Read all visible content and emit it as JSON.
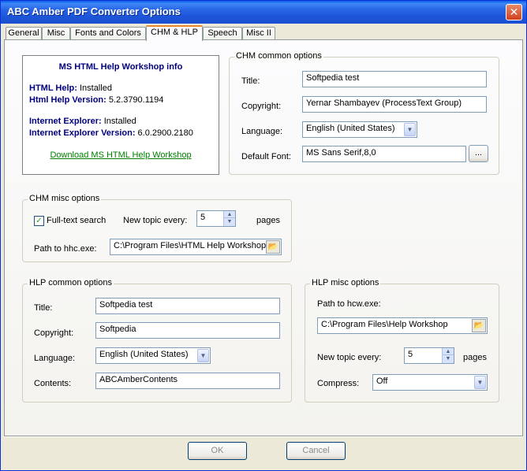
{
  "window": {
    "title": "ABC Amber PDF Converter Options",
    "close_glyph": "✕"
  },
  "tabs": [
    {
      "label": "General"
    },
    {
      "label": "Misc"
    },
    {
      "label": "Fonts and Colors"
    },
    {
      "label": "CHM & HLP"
    },
    {
      "label": "Speech"
    },
    {
      "label": "Misc II"
    }
  ],
  "info": {
    "heading": "MS HTML Help Workshop info",
    "html_help_label": "HTML Help:",
    "html_help_value": " Installed",
    "html_help_version_label": "Html Help Version:",
    "html_help_version_value": " 5.2.3790.1194",
    "ie_label": "Internet Explorer:",
    "ie_value": " Installed",
    "ie_version_label": "Internet Explorer Version:",
    "ie_version_value": " 6.0.2900.2180",
    "download_link": "Download MS HTML Help Workshop"
  },
  "chm_common": {
    "title": "CHM common options",
    "title_label": "Title:",
    "title_value": "Softpedia test",
    "copyright_label": "Copyright:",
    "copyright_value": "Yernar Shambayev (ProcessText Group)",
    "language_label": "Language:",
    "language_value": "English (United States)",
    "font_label": "Default Font:",
    "font_value": "MS Sans Serif,8,0",
    "font_button": "..."
  },
  "chm_misc": {
    "title": "CHM misc options",
    "fulltext_label": "Full-text search",
    "fulltext_checked": true,
    "new_topic_label": "New topic every:",
    "new_topic_value": "5",
    "pages_label": "pages",
    "path_label": "Path to hhc.exe:",
    "path_value": "C:\\Program Files\\HTML Help Workshop"
  },
  "hlp_common": {
    "title": "HLP common options",
    "title_label": "Title:",
    "title_value": "Softpedia test",
    "copyright_label": "Copyright:",
    "copyright_value": "Softpedia",
    "language_label": "Language:",
    "language_value": "English (United States)",
    "contents_label": "Contents:",
    "contents_value": "ABCAmberContents"
  },
  "hlp_misc": {
    "title": "HLP misc options",
    "path_label": "Path to hcw.exe:",
    "path_value": "C:\\Program Files\\Help Workshop",
    "new_topic_label": "New topic every:",
    "new_topic_value": "5",
    "pages_label": "pages",
    "compress_label": "Compress:",
    "compress_value": "Off"
  },
  "buttons": {
    "ok": "OK",
    "cancel": "Cancel"
  }
}
